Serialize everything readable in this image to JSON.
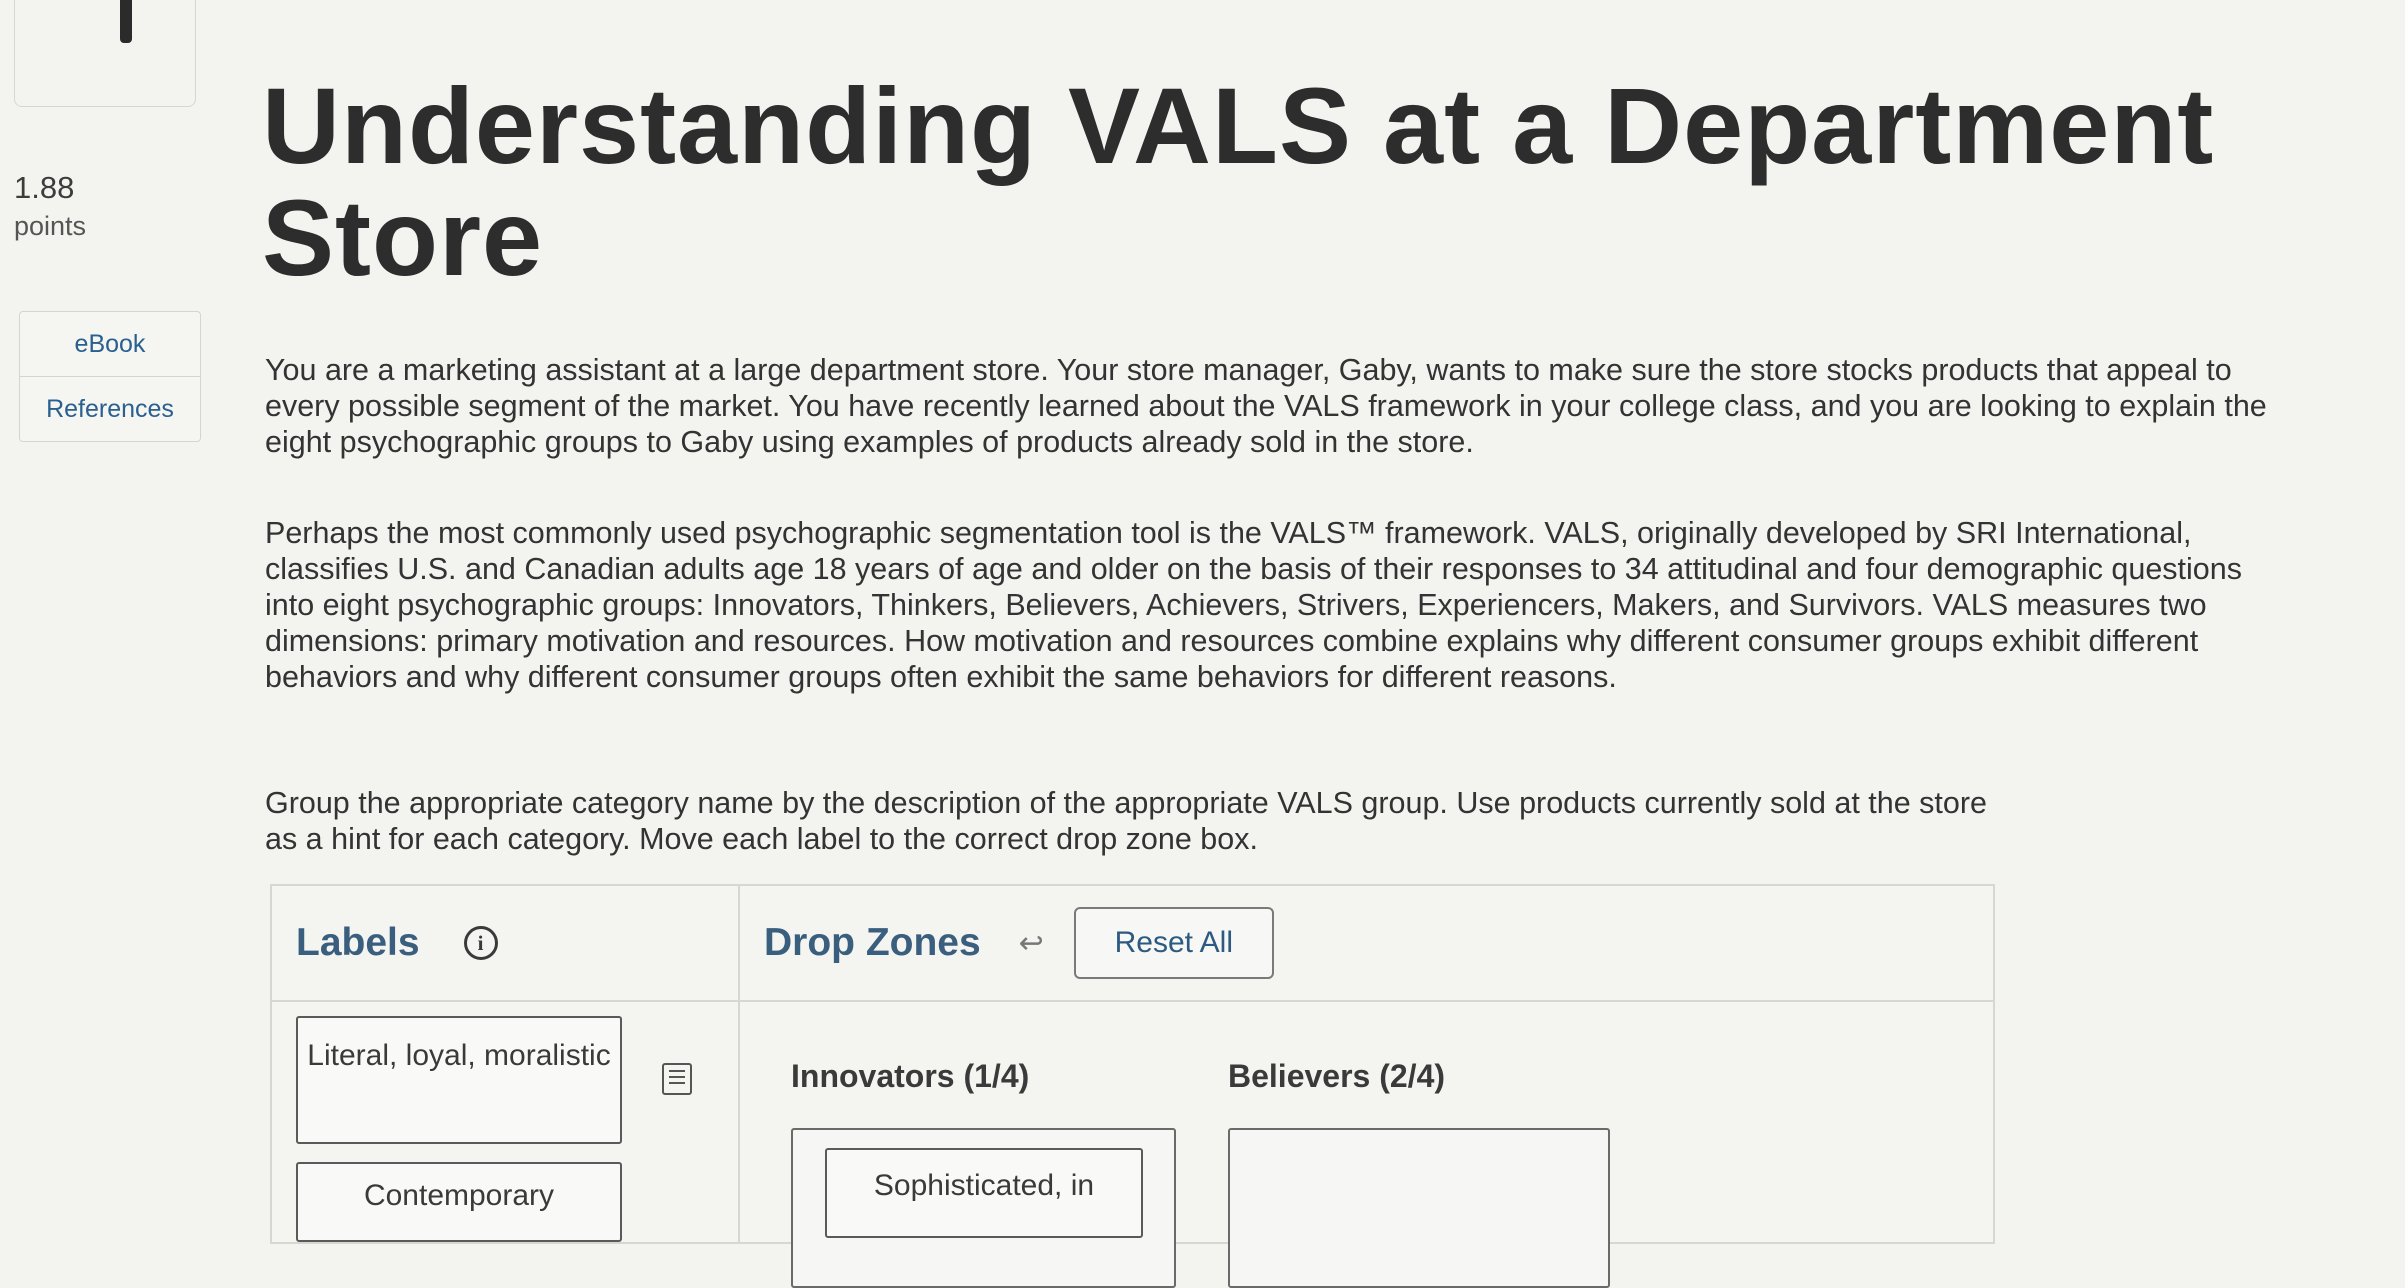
{
  "sidebar": {
    "points_value": "1.88",
    "points_label": "points",
    "links": [
      {
        "label": "eBook"
      },
      {
        "label": "References"
      }
    ]
  },
  "header": {
    "title": "Understanding VALS at a Department Store"
  },
  "content": {
    "paragraphs": [
      "You are a marketing assistant at a large department store. Your store manager, Gaby, wants to make sure the store stocks products that appeal to every possible segment of the market. You have recently learned about the VALS framework in your college class, and you are looking to explain the eight psychographic groups to Gaby using examples of products already sold in the store.",
      "Perhaps the most commonly used psychographic segmentation tool is the VALS™ framework. VALS, originally developed by SRI International, classifies U.S. and Canadian adults age 18 years of age and older on the basis of their responses to 34 attitudinal and four demographic questions into eight psychographic groups: Innovators, Thinkers, Believers, Achievers, Strivers, Experiencers, Makers, and Survivors. VALS measures two dimensions: primary motivation and resources. How motivation and resources combine explains why different consumer groups exhibit different behaviors and why different consumer groups often exhibit the same behaviors for different reasons.",
      "Group the appropriate category name by the description of the appropriate VALS group. Use products currently sold at the store as a hint for each category. Move each label to the correct drop zone box."
    ]
  },
  "activity": {
    "labels_title": "Labels",
    "dropzones_title": "Drop Zones",
    "reset_label": "Reset All",
    "labels": [
      {
        "text": "Literal, loyal, moralistic"
      },
      {
        "text": "Contemporary"
      }
    ],
    "dropzones": [
      {
        "title": "Innovators (1/4)",
        "items": [
          "Sophisticated, in"
        ]
      },
      {
        "title": "Believers (2/4)",
        "items": []
      }
    ]
  },
  "icons": {
    "info": "info-icon",
    "undo": "undo-arrow-icon",
    "notes": "notes-icon"
  }
}
